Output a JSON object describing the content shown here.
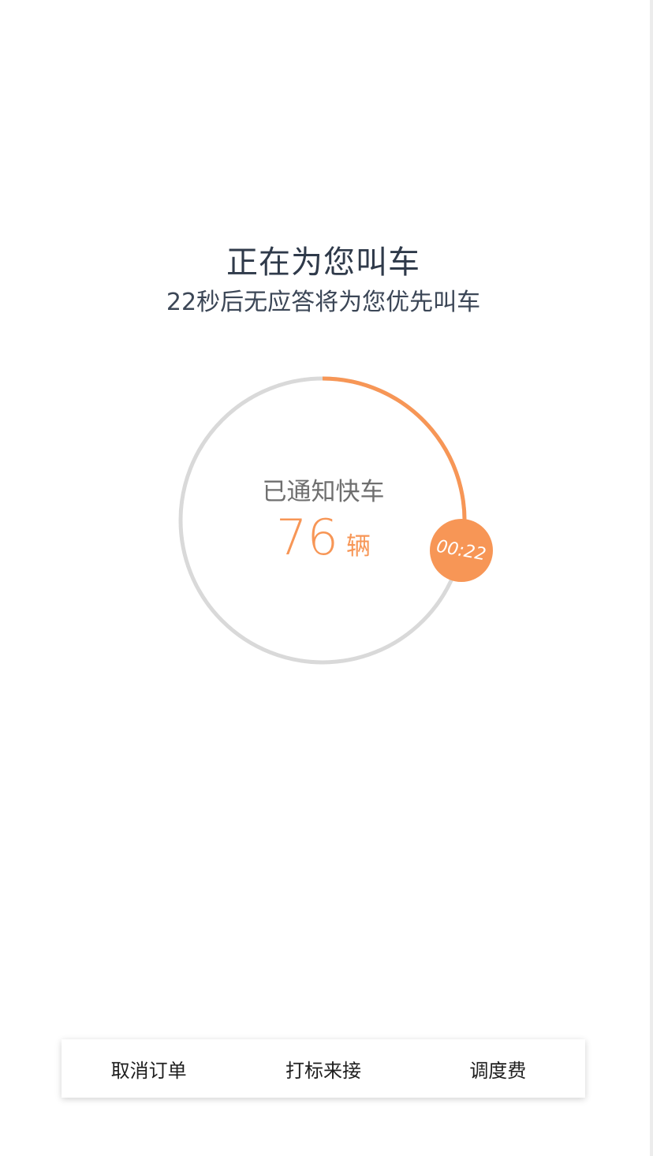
{
  "header": {
    "title": "正在为您叫车",
    "subtitle": "22秒后无应答将为您优先叫车"
  },
  "dial": {
    "label": "已通知快车",
    "count": "76",
    "unit": "辆",
    "timer": "00:22",
    "progress_fraction": 0.28,
    "colors": {
      "track": "#d9d9d9",
      "progress": "#f79656",
      "accent": "#f79656"
    }
  },
  "actions": {
    "cancel_label": "取消订单",
    "mark_pickup_label": "打标来接",
    "dispatch_fee_label": "调度费"
  }
}
